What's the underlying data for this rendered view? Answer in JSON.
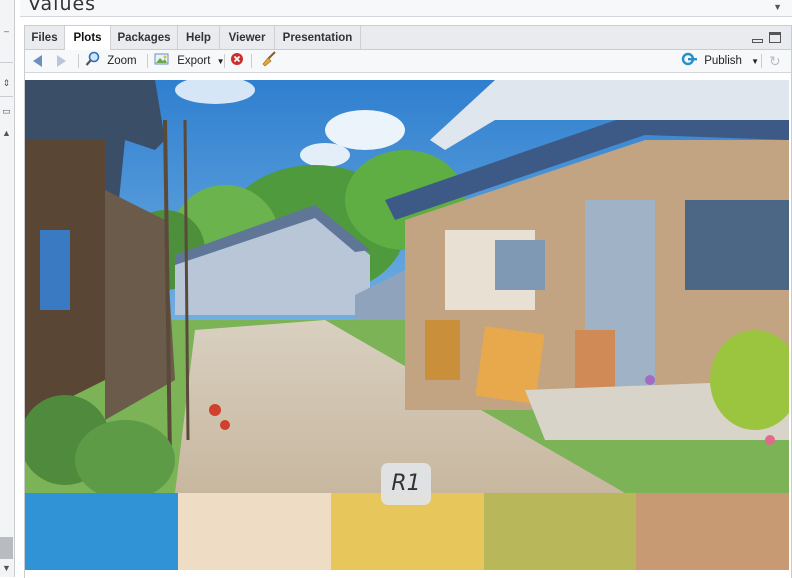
{
  "values_title": "Values",
  "tabs": [
    {
      "label": "Files"
    },
    {
      "label": "Plots"
    },
    {
      "label": "Packages"
    },
    {
      "label": "Help"
    },
    {
      "label": "Viewer"
    },
    {
      "label": "Presentation"
    }
  ],
  "active_tab": "Plots",
  "toolbar": {
    "zoom_label": "Zoom",
    "export_label": "Export",
    "publish_label": "Publish"
  },
  "plot": {
    "annotation_label": "R1",
    "palette_colors": [
      "#2f93d6",
      "#efdcc4",
      "#e7c65c",
      "#b8b85a",
      "#c89a73"
    ]
  }
}
